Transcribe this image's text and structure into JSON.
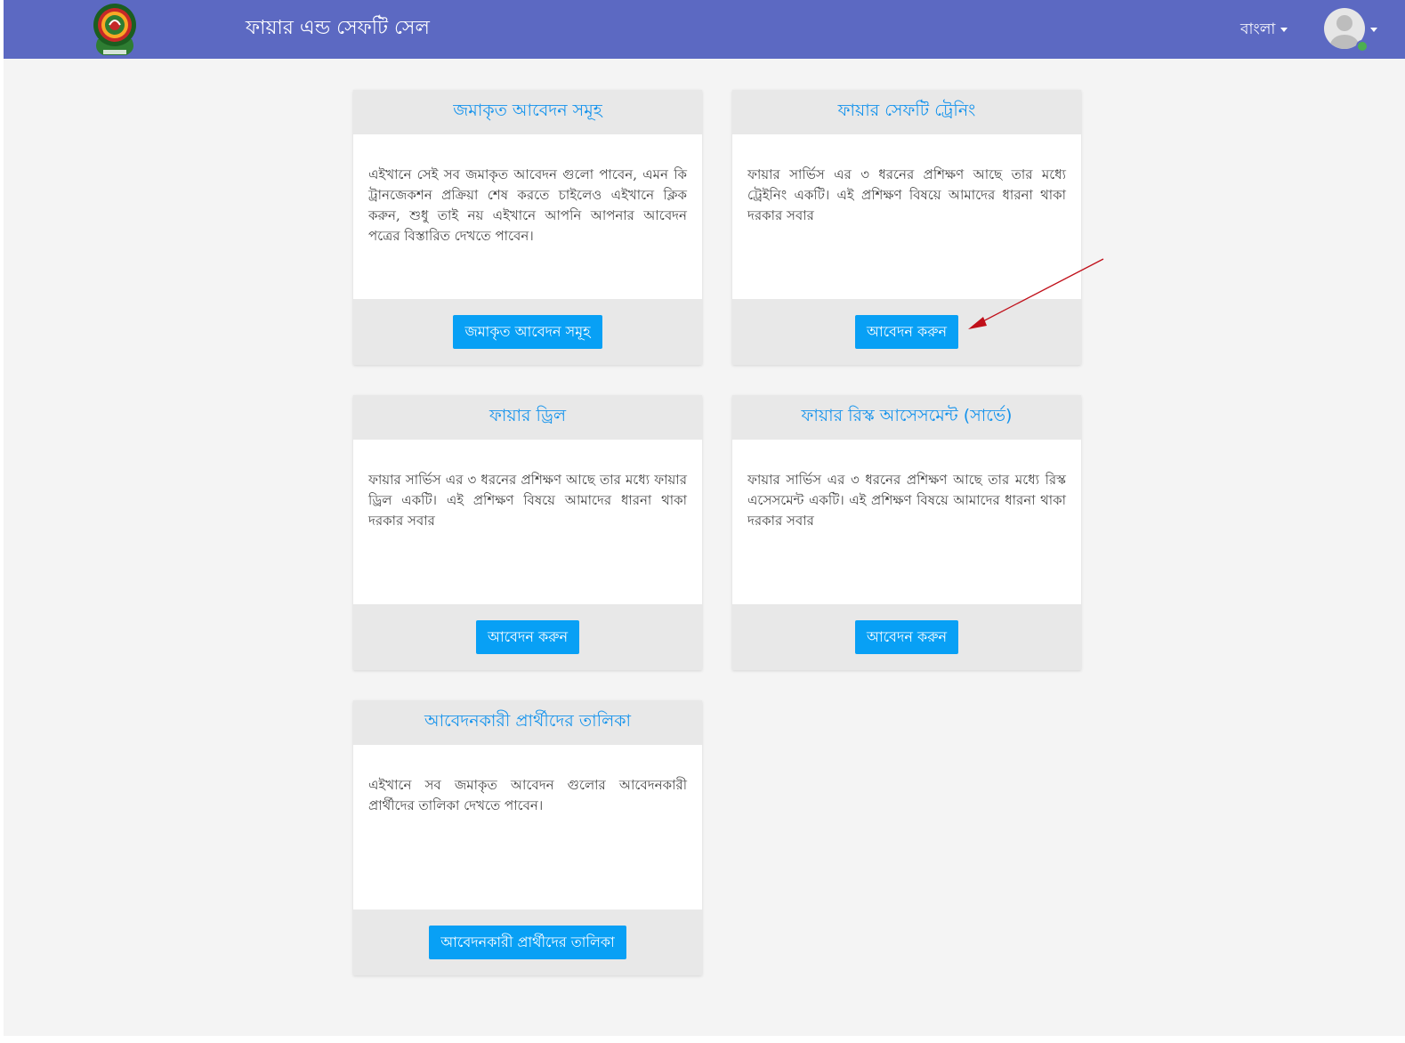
{
  "header": {
    "title": "ফায়ার এন্ড সেফটি সেল",
    "language": "বাংলা",
    "logo": "fire-service-emblem"
  },
  "colors": {
    "topbar": "#5c69c2",
    "card_title": "#1593ec",
    "button": "#08a0f5",
    "annotation_arrow": "#c0101a"
  },
  "cards": [
    {
      "title": "জমাকৃত আবেদন সমূহ",
      "body": "এইখানে সেই সব জমাকৃত আবেদন গুলো পাবেন, এমন কি ট্রানজেকশন প্রক্রিয়া শেষ করতে চাইলেও এইখানে ক্লিক করুন, শুধু তাই নয় এইখানে আপনি আপনার আবেদন পত্রের বিস্তারিত দেখতে পাবেন।",
      "button": "জমাকৃত আবেদন সমূহ"
    },
    {
      "title": "ফায়ার সেফটি ট্রেনিং",
      "body": "ফায়ার সার্ভিস এর ৩ ধরনের প্রশিক্ষণ আছে তার মধ্যে ট্রেইনিং একটি। এই প্রশিক্ষণ বিষয়ে আমাদের ধারনা থাকা দরকার সবার",
      "button": "আবেদন করুন"
    },
    {
      "title": "ফায়ার ড্রিল",
      "body": "ফায়ার সার্ভিস এর ৩ ধরনের প্রশিক্ষণ আছে তার মধ্যে ফায়ার ড্রিল একটি। এই প্রশিক্ষণ বিষয়ে আমাদের ধারনা থাকা দরকার সবার",
      "button": "আবেদন করুন"
    },
    {
      "title": "ফায়ার রিস্ক আসেসমেন্ট (সার্ভে)",
      "body": "ফায়ার সার্ভিস এর ৩ ধরনের প্রশিক্ষণ আছে তার মধ্যে রিস্ক এসেসমেন্ট একটি। এই প্রশিক্ষণ বিষয়ে আমাদের ধারনা থাকা দরকার সবার",
      "button": "আবেদন করুন"
    },
    {
      "title": "আবেদনকারী প্রার্থীদের তালিকা",
      "body": "এইখানে সব জমাকৃত আবেদন গুলোর আবেদনকারী প্রার্থীদের তালিকা দেখতে পাবেন।",
      "button": "আবেদনকারী প্রার্থীদের তালিকা"
    }
  ]
}
